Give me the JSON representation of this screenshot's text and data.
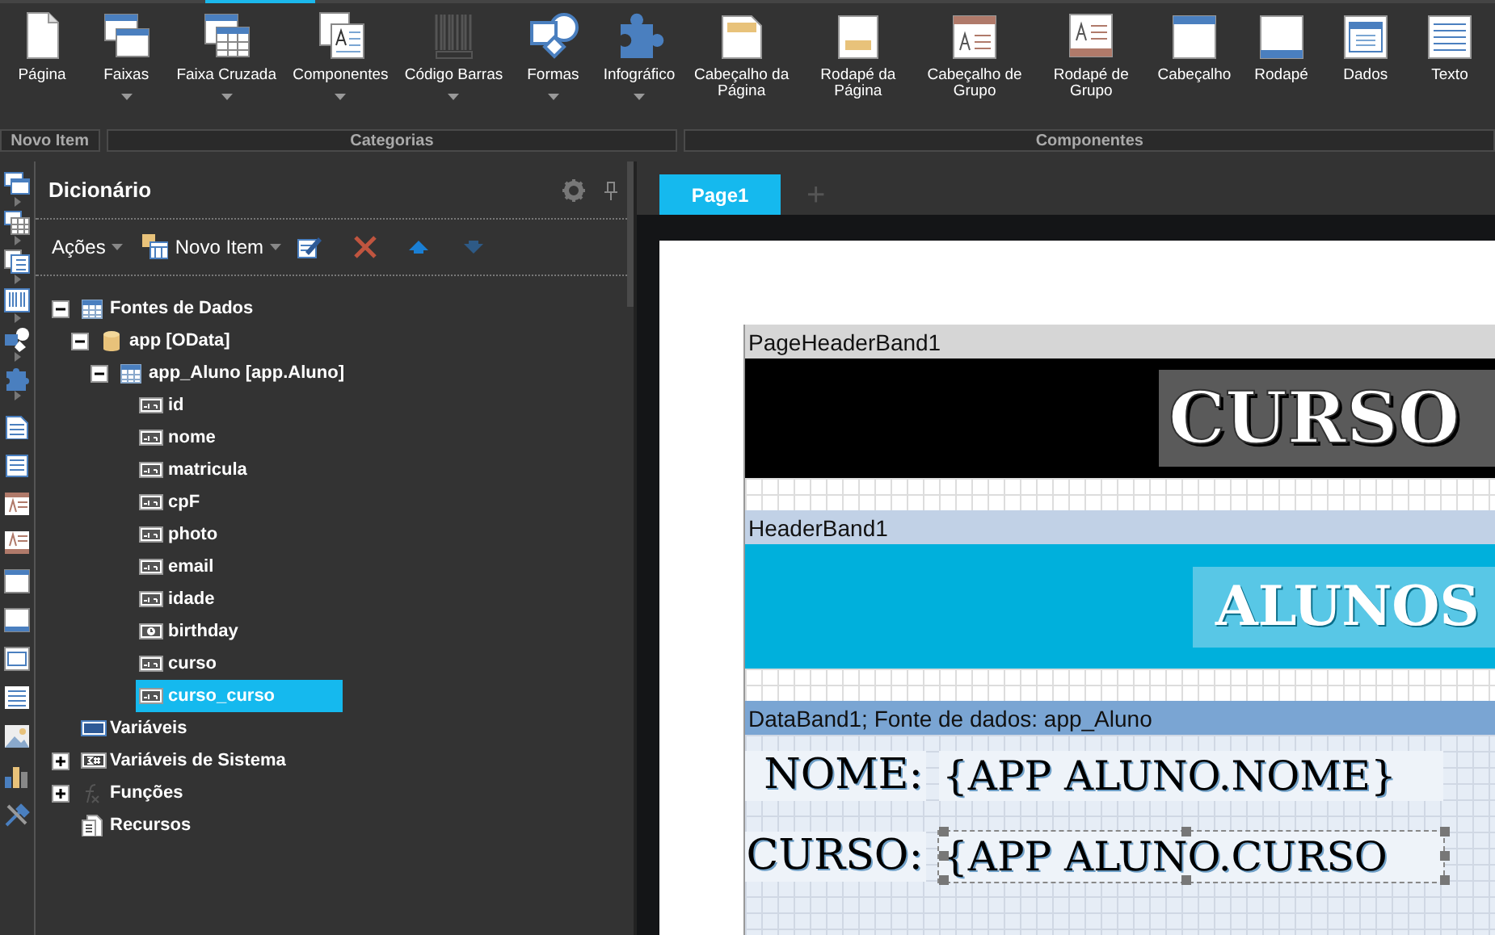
{
  "ribbon": {
    "items": [
      {
        "label": "Página",
        "dropdown": false
      },
      {
        "label": "Faixas",
        "dropdown": true
      },
      {
        "label": "Faixa Cruzada",
        "dropdown": true
      },
      {
        "label": "Componentes",
        "dropdown": true
      },
      {
        "label": "Código Barras",
        "dropdown": true
      },
      {
        "label": "Formas",
        "dropdown": true
      },
      {
        "label": "Infográfico",
        "dropdown": true
      },
      {
        "label": "Cabeçalho da Página",
        "dropdown": false
      },
      {
        "label": "Rodapé da Página",
        "dropdown": false
      },
      {
        "label": "Cabeçalho de Grupo",
        "dropdown": false
      },
      {
        "label": "Rodapé de Grupo",
        "dropdown": false
      },
      {
        "label": "Cabeçalho",
        "dropdown": false
      },
      {
        "label": "Rodapé",
        "dropdown": false
      },
      {
        "label": "Dados",
        "dropdown": false
      },
      {
        "label": "Texto",
        "dropdown": false
      }
    ],
    "groups": [
      "Novo Item",
      "Categorias",
      "Componentes"
    ]
  },
  "dictionary": {
    "title": "Dicionário",
    "actions": "Ações",
    "new_item": "Novo Item",
    "tree": [
      {
        "label": "Fontes de Dados",
        "kind": "table",
        "expanded": true,
        "selected": false,
        "children": [
          {
            "label": "app [OData]",
            "kind": "database",
            "expanded": true,
            "selected": false,
            "children": [
              {
                "label": "app_Aluno [app.Aluno]",
                "kind": "table",
                "expanded": true,
                "selected": false,
                "children": [
                  {
                    "label": "id",
                    "kind": "string",
                    "selected": false
                  },
                  {
                    "label": "nome",
                    "kind": "string",
                    "selected": false
                  },
                  {
                    "label": "matricula",
                    "kind": "string",
                    "selected": false
                  },
                  {
                    "label": "cpF",
                    "kind": "string",
                    "selected": false
                  },
                  {
                    "label": "photo",
                    "kind": "string",
                    "selected": false
                  },
                  {
                    "label": "email",
                    "kind": "string",
                    "selected": false
                  },
                  {
                    "label": "idade",
                    "kind": "string",
                    "selected": false
                  },
                  {
                    "label": "birthday",
                    "kind": "date",
                    "selected": false
                  },
                  {
                    "label": "curso",
                    "kind": "string",
                    "selected": false
                  },
                  {
                    "label": "curso_curso",
                    "kind": "string",
                    "selected": true
                  }
                ]
              }
            ]
          }
        ]
      },
      {
        "label": "Variáveis",
        "kind": "variables",
        "selected": false
      },
      {
        "label": "Variáveis de Sistema",
        "kind": "system",
        "expanded": false,
        "selected": false
      },
      {
        "label": "Funções",
        "kind": "function",
        "expanded": false,
        "selected": false
      },
      {
        "label": "Recursos",
        "kind": "resources",
        "selected": false
      }
    ]
  },
  "designer": {
    "tabs": [
      {
        "label": "Page1",
        "selected": true
      }
    ],
    "add_tab": "+",
    "bands": [
      {
        "kind": "page_header",
        "label": "PageHeaderBand1",
        "title": "CURSO"
      },
      {
        "kind": "header",
        "label": "HeaderBand1",
        "title": "ALUNOS"
      },
      {
        "kind": "data",
        "label": "DataBand1; Fonte de dados: app_Aluno",
        "rows": [
          {
            "label": "NOME:",
            "value": "{APP  ALUNO.NOME}",
            "selected": false
          },
          {
            "label": "CURSO:",
            "value": "{APP  ALUNO.CURSO",
            "selected": true
          }
        ]
      }
    ]
  }
}
